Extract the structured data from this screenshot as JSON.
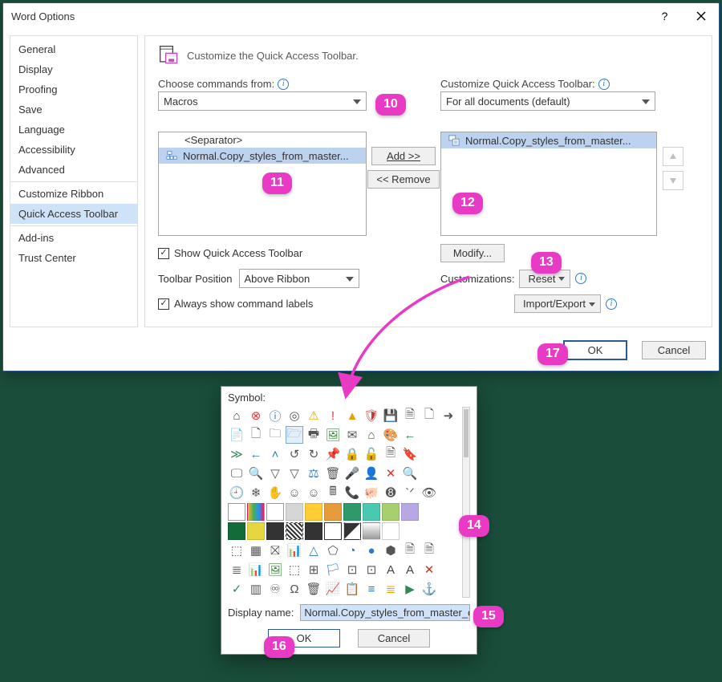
{
  "dialogTitle": "Word Options",
  "heading": "Customize the Quick Access Toolbar.",
  "sidebar": {
    "items": [
      "General",
      "Display",
      "Proofing",
      "Save",
      "Language",
      "Accessibility",
      "Advanced",
      "Customize Ribbon",
      "Quick Access Toolbar",
      "Add-ins",
      "Trust Center"
    ],
    "selectedIndex": 8
  },
  "labels": {
    "chooseFrom": "Choose commands from:",
    "customizeQat": "Customize Quick Access Toolbar:",
    "toolbarPosition": "Toolbar Position",
    "customizations": "Customizations:"
  },
  "dropdowns": {
    "chooseFrom": "Macros",
    "customizeQat": "For all documents (default)",
    "toolbarPosition": "Above Ribbon",
    "reset": "Reset",
    "importExport": "Import/Export"
  },
  "leftList": {
    "separator": "<Separator>",
    "items": [
      {
        "label": "Normal.Copy_styles_from_master...",
        "icon": "macro"
      }
    ],
    "selectedIndex": 0
  },
  "rightList": {
    "items": [
      {
        "label": "Normal.Copy_styles_from_master...",
        "icon": "macro-save"
      }
    ],
    "selectedIndex": 0
  },
  "buttons": {
    "add": "Add >>",
    "remove": "<< Remove",
    "modify": "Modify...",
    "ok": "OK",
    "cancel": "Cancel"
  },
  "checkboxes": {
    "showQat": {
      "label": "Show Quick Access Toolbar",
      "checked": true
    },
    "alwaysLabels": {
      "label": "Always show command labels",
      "checked": true
    }
  },
  "symbolDlg": {
    "title": "Symbol:",
    "displayNameLabel": "Display name:",
    "displayNameValue": "Normal.Copy_styles_from_master_doc.",
    "ok": "OK",
    "cancel": "Cancel",
    "selectedRow": 1,
    "selectedCol": 3,
    "rows": [
      [
        {
          "t": "g",
          "v": "⌂",
          "c": "#444"
        },
        {
          "t": "g",
          "v": "⊗",
          "c": "#e03535"
        },
        {
          "t": "g",
          "v": "ⓘ",
          "c": "#2f78c5"
        },
        {
          "t": "g",
          "v": "◎",
          "c": "#555"
        },
        {
          "t": "g",
          "v": "⚠",
          "c": "#e8a200"
        },
        {
          "t": "g",
          "v": "!",
          "c": "#e03535"
        },
        {
          "t": "g",
          "v": "▲",
          "c": "#e8a200"
        },
        {
          "t": "g",
          "v": "🛡",
          "c": "#c23a3a"
        },
        {
          "t": "g",
          "v": "💾",
          "c": "#8e44ad"
        },
        {
          "t": "g",
          "v": "🗎",
          "c": "#555"
        },
        {
          "t": "g",
          "v": "🗋",
          "c": "#555"
        },
        {
          "t": "g",
          "v": "➜",
          "c": "#555"
        }
      ],
      [
        {
          "t": "g",
          "v": "📄",
          "c": "#555"
        },
        {
          "t": "g",
          "v": "🗋",
          "c": "#555"
        },
        {
          "t": "g",
          "v": "🗀",
          "c": "#555"
        },
        {
          "t": "g",
          "v": "🗁",
          "c": "#6aa7e2"
        },
        {
          "t": "g",
          "v": "🖶",
          "c": "#555"
        },
        {
          "t": "g",
          "v": "🖼",
          "c": "#3a8a3a"
        },
        {
          "t": "g",
          "v": "✉",
          "c": "#555"
        },
        {
          "t": "g",
          "v": "⌂",
          "c": "#555"
        },
        {
          "t": "g",
          "v": "🎨",
          "c": "#555"
        },
        {
          "t": "g",
          "v": "←",
          "c": "#2e8b57"
        },
        {
          "t": "empty"
        },
        {
          "t": "empty"
        }
      ],
      [
        {
          "t": "g",
          "v": "≫",
          "c": "#2e8b57"
        },
        {
          "t": "g",
          "v": "←",
          "c": "#2f78c5"
        },
        {
          "t": "g",
          "v": "˄",
          "c": "#2f78c5"
        },
        {
          "t": "g",
          "v": "↺",
          "c": "#555"
        },
        {
          "t": "g",
          "v": "↻",
          "c": "#555"
        },
        {
          "t": "g",
          "v": "📌",
          "c": "#555"
        },
        {
          "t": "g",
          "v": "🔒",
          "c": "#555"
        },
        {
          "t": "g",
          "v": "🔓",
          "c": "#555"
        },
        {
          "t": "g",
          "v": "🗎",
          "c": "#555"
        },
        {
          "t": "g",
          "v": "🔖",
          "c": "#555"
        },
        {
          "t": "empty"
        },
        {
          "t": "empty"
        }
      ],
      [
        {
          "t": "g",
          "v": "🖵",
          "c": "#555"
        },
        {
          "t": "g",
          "v": "🔍",
          "c": "#555"
        },
        {
          "t": "g",
          "v": "▽",
          "c": "#555"
        },
        {
          "t": "g",
          "v": "▽",
          "c": "#555"
        },
        {
          "t": "g",
          "v": "⚖",
          "c": "#2f78c5"
        },
        {
          "t": "g",
          "v": "🗑",
          "c": "#555"
        },
        {
          "t": "g",
          "v": "🎤",
          "c": "#555"
        },
        {
          "t": "g",
          "v": "👤",
          "c": "#555"
        },
        {
          "t": "g",
          "v": "✕",
          "c": "#e03535"
        },
        {
          "t": "g",
          "v": "🔍",
          "c": "#555"
        },
        {
          "t": "empty"
        },
        {
          "t": "empty"
        }
      ],
      [
        {
          "t": "g",
          "v": "🕘",
          "c": "#555"
        },
        {
          "t": "g",
          "v": "❄",
          "c": "#555"
        },
        {
          "t": "g",
          "v": "✋",
          "c": "#555"
        },
        {
          "t": "g",
          "v": "☺",
          "c": "#555"
        },
        {
          "t": "g",
          "v": "☺",
          "c": "#555"
        },
        {
          "t": "g",
          "v": "🖩",
          "c": "#555"
        },
        {
          "t": "g",
          "v": "📞",
          "c": "#555"
        },
        {
          "t": "g",
          "v": "🐖",
          "c": "#555"
        },
        {
          "t": "g",
          "v": "➑",
          "c": "#555"
        },
        {
          "t": "g",
          "v": "`ᐟ",
          "c": "#555"
        },
        {
          "t": "g",
          "v": "👁",
          "c": "#555"
        },
        {
          "t": "empty"
        }
      ],
      [
        {
          "t": "s",
          "bg": "#ffffff",
          "brd": "#999"
        },
        {
          "t": "s",
          "bg": "linear-gradient(90deg,#f7b733,#4caf50,#2196f3,#e91e63)"
        },
        {
          "t": "s",
          "bg": "#ffffff",
          "brd": "#999"
        },
        {
          "t": "s",
          "bg": "#d6d6d6"
        },
        {
          "t": "s",
          "bg": "#ffcc33"
        },
        {
          "t": "s",
          "bg": "#e89b3a"
        },
        {
          "t": "s",
          "bg": "#2e9a6a"
        },
        {
          "t": "s",
          "bg": "#48c9b0"
        },
        {
          "t": "s",
          "bg": "#a7cf6e"
        },
        {
          "t": "s",
          "bg": "#b8a7e5"
        },
        {
          "t": "empty"
        },
        {
          "t": "empty"
        }
      ],
      [
        {
          "t": "s",
          "bg": "#146b3a"
        },
        {
          "t": "s",
          "bg": "#e8d640"
        },
        {
          "t": "s",
          "bg": "#333333"
        },
        {
          "t": "s",
          "bg": "repeating-linear-gradient(45deg,#333 0,#333 2px,#fff 2px,#fff 4px)"
        },
        {
          "t": "s",
          "bg": "#333333"
        },
        {
          "t": "s",
          "bg": "#ffffff",
          "brd": "#333"
        },
        {
          "t": "s",
          "bg": "linear-gradient(135deg,#333 49%,#fff 51%)"
        },
        {
          "t": "s",
          "bg": "linear-gradient(#fff,#999)"
        },
        {
          "t": "s",
          "bg": "#ffffff",
          "brd": "#ccc"
        },
        {
          "t": "empty"
        },
        {
          "t": "empty"
        },
        {
          "t": "empty"
        }
      ],
      [
        {
          "t": "g",
          "v": "⬚",
          "c": "#555"
        },
        {
          "t": "g",
          "v": "▦",
          "c": "#555"
        },
        {
          "t": "g",
          "v": "⛝",
          "c": "#555"
        },
        {
          "t": "g",
          "v": "📊",
          "c": "#2e8b57"
        },
        {
          "t": "g",
          "v": "△",
          "c": "#2f78c5"
        },
        {
          "t": "g",
          "v": "⬠",
          "c": "#555"
        },
        {
          "t": "g",
          "v": "◔",
          "c": "#2f78c5"
        },
        {
          "t": "g",
          "v": "●",
          "c": "#2f78c5"
        },
        {
          "t": "g",
          "v": "⬢",
          "c": "#555"
        },
        {
          "t": "g",
          "v": "🗎",
          "c": "#555"
        },
        {
          "t": "g",
          "v": "🗎",
          "c": "#555"
        },
        {
          "t": "empty"
        }
      ],
      [
        {
          "t": "g",
          "v": "≣",
          "c": "#555"
        },
        {
          "t": "g",
          "v": "📊",
          "c": "#555"
        },
        {
          "t": "g",
          "v": "🖼",
          "c": "#3a8a3a"
        },
        {
          "t": "g",
          "v": "⬚",
          "c": "#555"
        },
        {
          "t": "g",
          "v": "⊞",
          "c": "#555"
        },
        {
          "t": "g",
          "v": "🏳",
          "c": "#2f78c5"
        },
        {
          "t": "g",
          "v": "⊡",
          "c": "#555"
        },
        {
          "t": "g",
          "v": "⊡",
          "c": "#555"
        },
        {
          "t": "g",
          "v": "A",
          "c": "#444"
        },
        {
          "t": "g",
          "v": "A",
          "c": "#444"
        },
        {
          "t": "g",
          "v": "✕",
          "c": "#c0392b"
        },
        {
          "t": "empty"
        }
      ],
      [
        {
          "t": "g",
          "v": "✓",
          "c": "#2e8b57"
        },
        {
          "t": "g",
          "v": "▥",
          "c": "#555"
        },
        {
          "t": "g",
          "v": "♾",
          "c": "#555"
        },
        {
          "t": "g",
          "v": "Ω",
          "c": "#555"
        },
        {
          "t": "g",
          "v": "🗑",
          "c": "#555"
        },
        {
          "t": "g",
          "v": "📈",
          "c": "#2f78c5"
        },
        {
          "t": "g",
          "v": "📋",
          "c": "#555"
        },
        {
          "t": "g",
          "v": "≡",
          "c": "#2f78c5"
        },
        {
          "t": "g",
          "v": "≣",
          "c": "#e8a200"
        },
        {
          "t": "g",
          "v": "▶",
          "c": "#2e8b57"
        },
        {
          "t": "g",
          "v": "⚓",
          "c": "#2f78c5"
        },
        {
          "t": "empty"
        }
      ]
    ]
  },
  "badges": {
    "b10": "10",
    "b11": "11",
    "b12": "12",
    "b13": "13",
    "b14": "14",
    "b15": "15",
    "b16": "16",
    "b17": "17"
  }
}
